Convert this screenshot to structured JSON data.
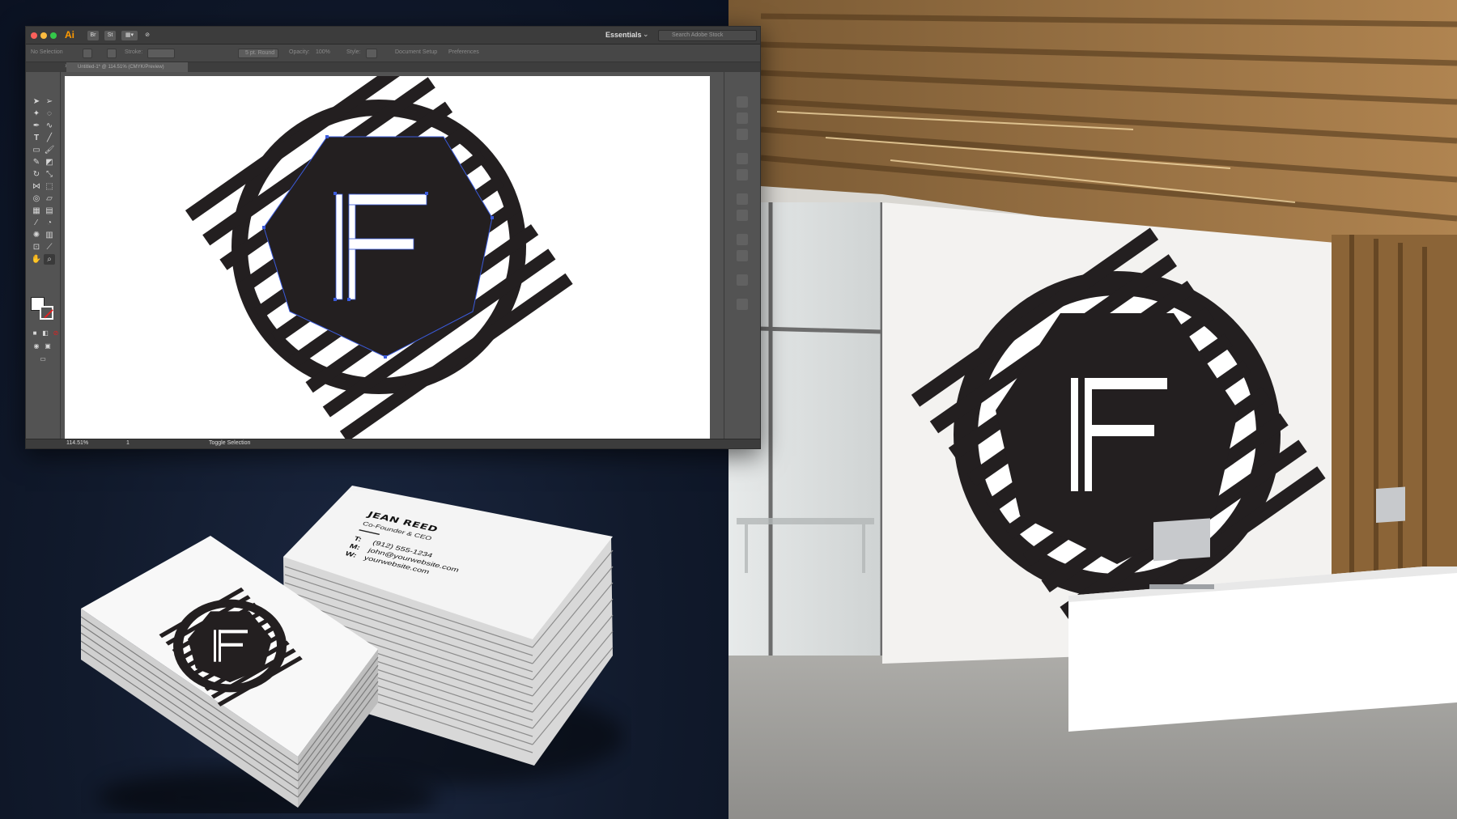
{
  "illustrator": {
    "app_logo": "Ai",
    "bridge_label": "Br",
    "stock_label": "St",
    "workspace": "Essentials",
    "search_placeholder": "Search Adobe Stock",
    "control_bar": {
      "selection": "No Selection",
      "stroke": "Stroke:",
      "opacity": "Opacity:",
      "opacity_value": "100%",
      "style": "Style:",
      "document_setup": "Document Setup",
      "preferences": "Preferences",
      "brush": "5 pt. Round"
    },
    "doc_tab": "Untitled-1* @ 114.51% (CMYK/Preview)",
    "status": {
      "zoom": "114.51%",
      "artboard": "1",
      "toggle": "Toggle Selection"
    },
    "colors": {
      "accent": "#ff9a00",
      "chrome": "#535353",
      "selection": "#3b5bdb"
    }
  },
  "logo": {
    "letter": "F",
    "color": "#231f20"
  },
  "business_card": {
    "name": "JEAN REED",
    "title": "Co-Founder & CEO",
    "phone_label": "T:",
    "phone": "(912) 555-1234",
    "email_label": "M:",
    "email": "john@yourwebsite.com",
    "web_label": "W:",
    "web": "yourwebsite.com"
  }
}
